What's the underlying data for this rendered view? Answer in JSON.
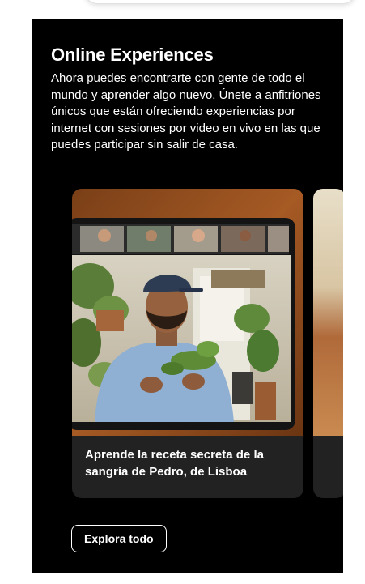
{
  "section": {
    "title": "Online Experiences",
    "description": "Ahora puedes encontrarte con gente de todo el mundo y aprender algo nuevo. Únete a anfitriones únicos que están ofreciendo experiencias por internet con sesiones por video en vivo en las que puedes participar sin salir de casa."
  },
  "cards": [
    {
      "caption": "Aprende la receta secreta de la sangría de Pedro, de Lisboa"
    }
  ],
  "actions": {
    "explore_label": "Explora todo"
  }
}
